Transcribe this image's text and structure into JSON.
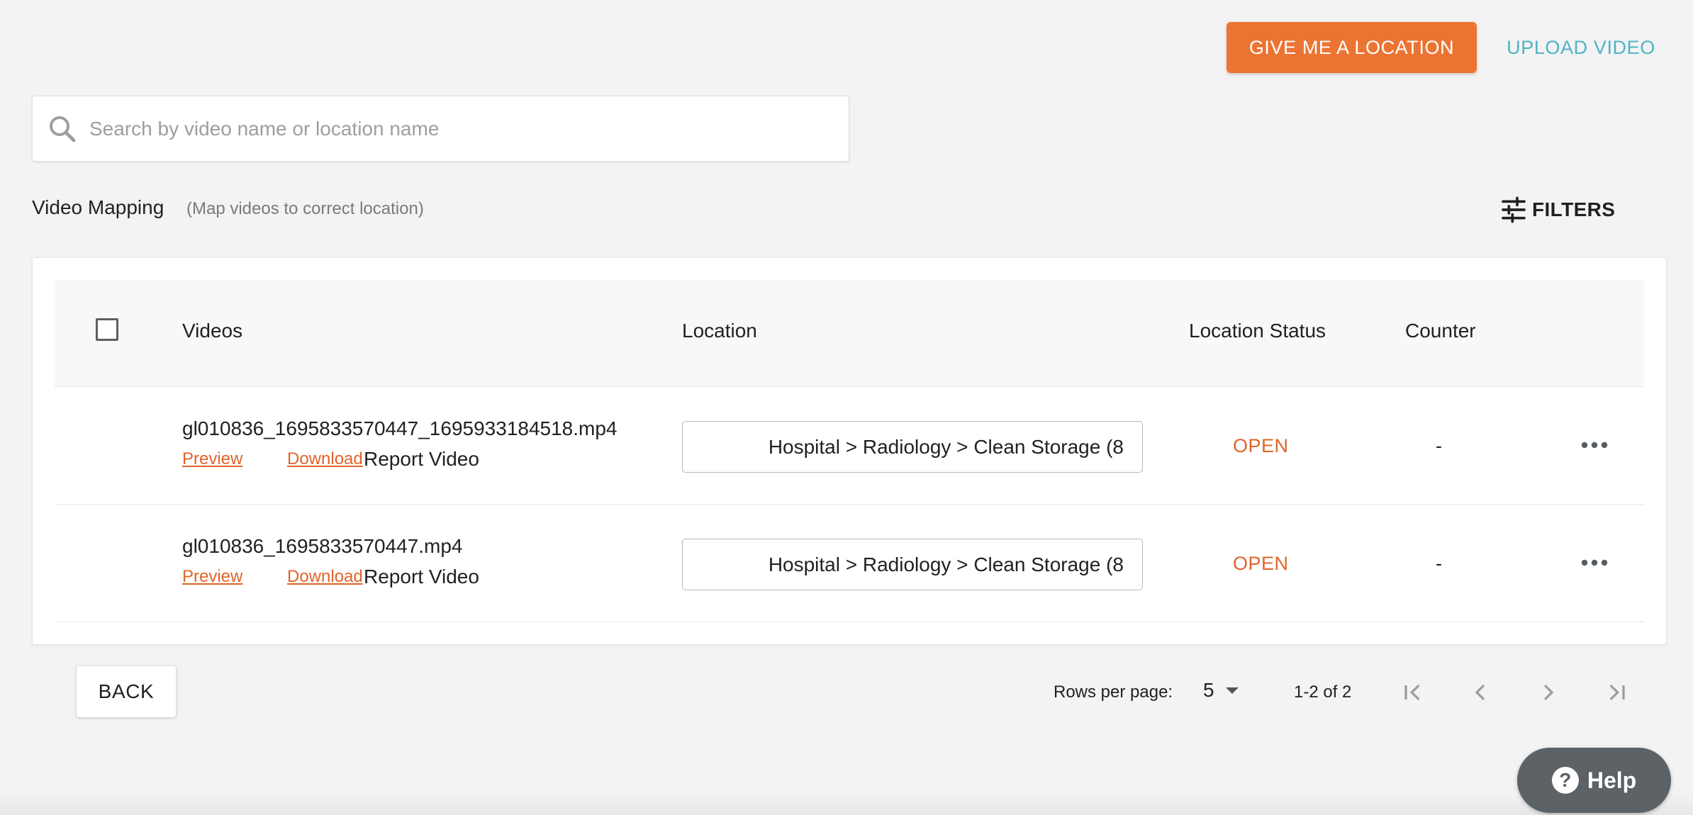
{
  "header": {
    "give_location_label": "GIVE ME A LOCATION",
    "upload_video_label": "UPLOAD VIDEO"
  },
  "search": {
    "placeholder": "Search by video name or location name",
    "value": ""
  },
  "section": {
    "title": "Video Mapping",
    "subtitle": "(Map videos to correct location)",
    "filters_label": "FILTERS"
  },
  "table": {
    "columns": {
      "videos": "Videos",
      "location": "Location",
      "status": "Location Status",
      "counter": "Counter"
    },
    "rows": [
      {
        "filename": "gl010836_1695833570447_1695933184518.mp4",
        "preview": "Preview",
        "download": "Download",
        "report": "Report Video",
        "location": "Hospital > Radiology > Clean Storage (8",
        "status": "OPEN",
        "counter": "-"
      },
      {
        "filename": "gl010836_1695833570447.mp4",
        "preview": "Preview",
        "download": "Download",
        "report": "Report Video",
        "location": "Hospital > Radiology > Clean Storage (8",
        "status": "OPEN",
        "counter": "-"
      }
    ]
  },
  "footer": {
    "back_label": "BACK",
    "rows_per_page_label": "Rows per page:",
    "rows_per_page_value": "5",
    "page_range": "1-2 of 2"
  },
  "help": {
    "label": "Help"
  },
  "colors": {
    "accent_orange": "#ec7432",
    "link_orange": "#e0642a",
    "upload_teal": "#4fb3c8",
    "help_gray": "#5d6266"
  }
}
